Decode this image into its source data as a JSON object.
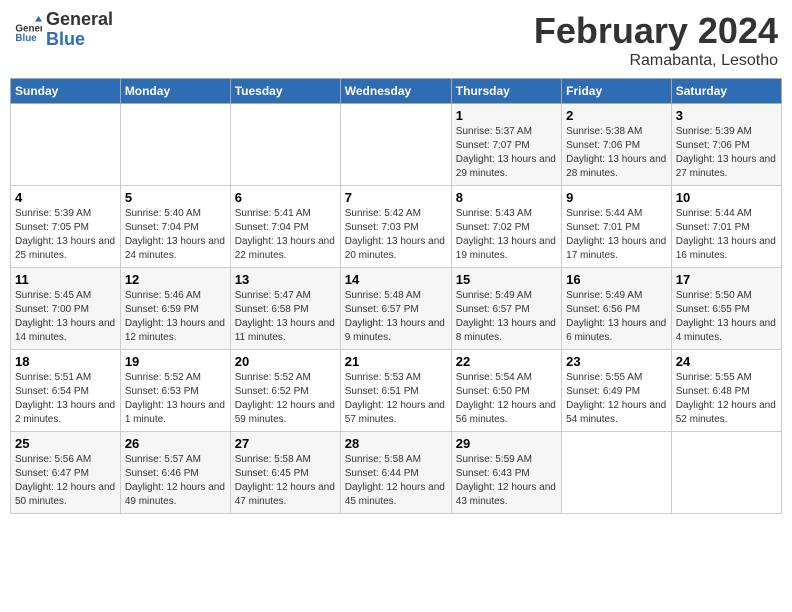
{
  "header": {
    "logo_general": "General",
    "logo_blue": "Blue",
    "month_year": "February 2024",
    "location": "Ramabanta, Lesotho"
  },
  "days_of_week": [
    "Sunday",
    "Monday",
    "Tuesday",
    "Wednesday",
    "Thursday",
    "Friday",
    "Saturday"
  ],
  "weeks": [
    [
      {
        "day": "",
        "sunrise": "",
        "sunset": "",
        "daylight": ""
      },
      {
        "day": "",
        "sunrise": "",
        "sunset": "",
        "daylight": ""
      },
      {
        "day": "",
        "sunrise": "",
        "sunset": "",
        "daylight": ""
      },
      {
        "day": "",
        "sunrise": "",
        "sunset": "",
        "daylight": ""
      },
      {
        "day": "1",
        "sunrise": "5:37 AM",
        "sunset": "7:07 PM",
        "daylight": "13 hours and 29 minutes."
      },
      {
        "day": "2",
        "sunrise": "5:38 AM",
        "sunset": "7:06 PM",
        "daylight": "13 hours and 28 minutes."
      },
      {
        "day": "3",
        "sunrise": "5:39 AM",
        "sunset": "7:06 PM",
        "daylight": "13 hours and 27 minutes."
      }
    ],
    [
      {
        "day": "4",
        "sunrise": "5:39 AM",
        "sunset": "7:05 PM",
        "daylight": "13 hours and 25 minutes."
      },
      {
        "day": "5",
        "sunrise": "5:40 AM",
        "sunset": "7:04 PM",
        "daylight": "13 hours and 24 minutes."
      },
      {
        "day": "6",
        "sunrise": "5:41 AM",
        "sunset": "7:04 PM",
        "daylight": "13 hours and 22 minutes."
      },
      {
        "day": "7",
        "sunrise": "5:42 AM",
        "sunset": "7:03 PM",
        "daylight": "13 hours and 20 minutes."
      },
      {
        "day": "8",
        "sunrise": "5:43 AM",
        "sunset": "7:02 PM",
        "daylight": "13 hours and 19 minutes."
      },
      {
        "day": "9",
        "sunrise": "5:44 AM",
        "sunset": "7:01 PM",
        "daylight": "13 hours and 17 minutes."
      },
      {
        "day": "10",
        "sunrise": "5:44 AM",
        "sunset": "7:01 PM",
        "daylight": "13 hours and 16 minutes."
      }
    ],
    [
      {
        "day": "11",
        "sunrise": "5:45 AM",
        "sunset": "7:00 PM",
        "daylight": "13 hours and 14 minutes."
      },
      {
        "day": "12",
        "sunrise": "5:46 AM",
        "sunset": "6:59 PM",
        "daylight": "13 hours and 12 minutes."
      },
      {
        "day": "13",
        "sunrise": "5:47 AM",
        "sunset": "6:58 PM",
        "daylight": "13 hours and 11 minutes."
      },
      {
        "day": "14",
        "sunrise": "5:48 AM",
        "sunset": "6:57 PM",
        "daylight": "13 hours and 9 minutes."
      },
      {
        "day": "15",
        "sunrise": "5:49 AM",
        "sunset": "6:57 PM",
        "daylight": "13 hours and 8 minutes."
      },
      {
        "day": "16",
        "sunrise": "5:49 AM",
        "sunset": "6:56 PM",
        "daylight": "13 hours and 6 minutes."
      },
      {
        "day": "17",
        "sunrise": "5:50 AM",
        "sunset": "6:55 PM",
        "daylight": "13 hours and 4 minutes."
      }
    ],
    [
      {
        "day": "18",
        "sunrise": "5:51 AM",
        "sunset": "6:54 PM",
        "daylight": "13 hours and 2 minutes."
      },
      {
        "day": "19",
        "sunrise": "5:52 AM",
        "sunset": "6:53 PM",
        "daylight": "13 hours and 1 minute."
      },
      {
        "day": "20",
        "sunrise": "5:52 AM",
        "sunset": "6:52 PM",
        "daylight": "12 hours and 59 minutes."
      },
      {
        "day": "21",
        "sunrise": "5:53 AM",
        "sunset": "6:51 PM",
        "daylight": "12 hours and 57 minutes."
      },
      {
        "day": "22",
        "sunrise": "5:54 AM",
        "sunset": "6:50 PM",
        "daylight": "12 hours and 56 minutes."
      },
      {
        "day": "23",
        "sunrise": "5:55 AM",
        "sunset": "6:49 PM",
        "daylight": "12 hours and 54 minutes."
      },
      {
        "day": "24",
        "sunrise": "5:55 AM",
        "sunset": "6:48 PM",
        "daylight": "12 hours and 52 minutes."
      }
    ],
    [
      {
        "day": "25",
        "sunrise": "5:56 AM",
        "sunset": "6:47 PM",
        "daylight": "12 hours and 50 minutes."
      },
      {
        "day": "26",
        "sunrise": "5:57 AM",
        "sunset": "6:46 PM",
        "daylight": "12 hours and 49 minutes."
      },
      {
        "day": "27",
        "sunrise": "5:58 AM",
        "sunset": "6:45 PM",
        "daylight": "12 hours and 47 minutes."
      },
      {
        "day": "28",
        "sunrise": "5:58 AM",
        "sunset": "6:44 PM",
        "daylight": "12 hours and 45 minutes."
      },
      {
        "day": "29",
        "sunrise": "5:59 AM",
        "sunset": "6:43 PM",
        "daylight": "12 hours and 43 minutes."
      },
      {
        "day": "",
        "sunrise": "",
        "sunset": "",
        "daylight": ""
      },
      {
        "day": "",
        "sunrise": "",
        "sunset": "",
        "daylight": ""
      }
    ]
  ]
}
